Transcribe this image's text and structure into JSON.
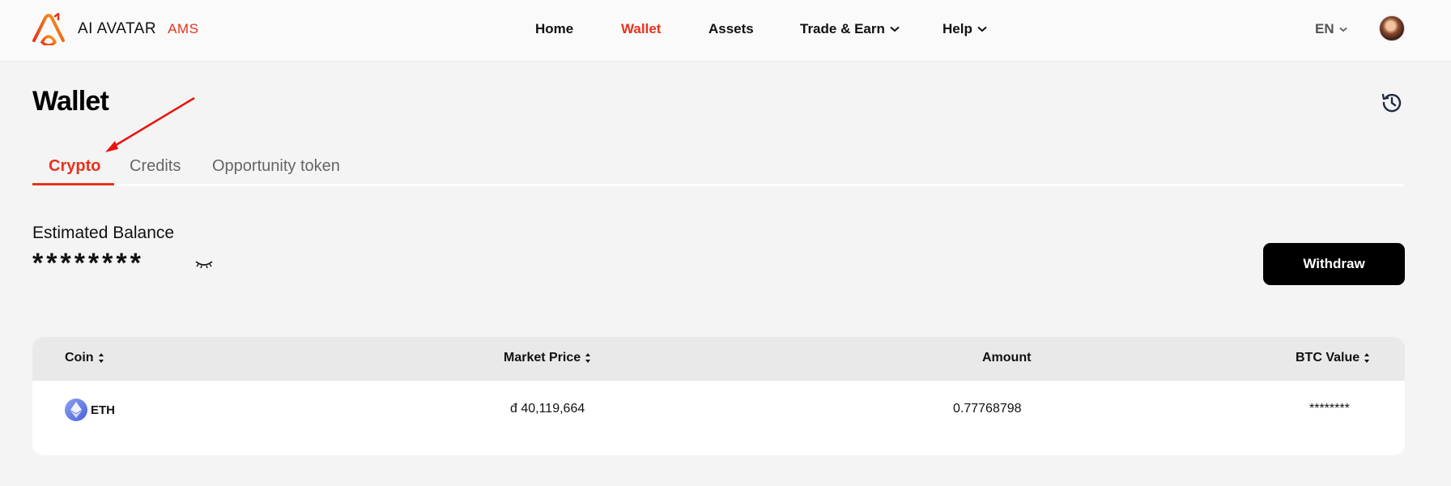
{
  "header": {
    "brand": "AI AVATAR",
    "brand_sub": "AMS",
    "nav": [
      {
        "label": "Home",
        "active": false
      },
      {
        "label": "Wallet",
        "active": true
      },
      {
        "label": "Assets",
        "active": false
      },
      {
        "label": "Trade & Earn",
        "active": false,
        "dropdown": true
      },
      {
        "label": "Help",
        "active": false,
        "dropdown": true
      }
    ],
    "language": "EN"
  },
  "page": {
    "title": "Wallet",
    "tabs": [
      {
        "label": "Crypto",
        "active": true
      },
      {
        "label": "Credits",
        "active": false
      },
      {
        "label": "Opportunity token",
        "active": false
      }
    ]
  },
  "balance": {
    "label": "Estimated Balance",
    "value": "********",
    "withdraw_label": "Withdraw"
  },
  "table": {
    "columns": [
      {
        "label": "Coin",
        "sortable": true
      },
      {
        "label": "Market Price",
        "sortable": true
      },
      {
        "label": "Amount",
        "sortable": false
      },
      {
        "label": "BTC Value",
        "sortable": true
      }
    ],
    "rows": [
      {
        "coin": "ETH",
        "market_price": "đ 40,119,664",
        "amount": "0.77768798",
        "btc_value": "********"
      }
    ]
  },
  "colors": {
    "accent": "#e8321c",
    "button_bg": "#000000",
    "page_bg": "#f4f4f4"
  },
  "icons": [
    "brand-logo-icon",
    "chevron-down-icon",
    "history-icon",
    "eye-closed-icon",
    "sort-icon",
    "ethereum-icon"
  ]
}
